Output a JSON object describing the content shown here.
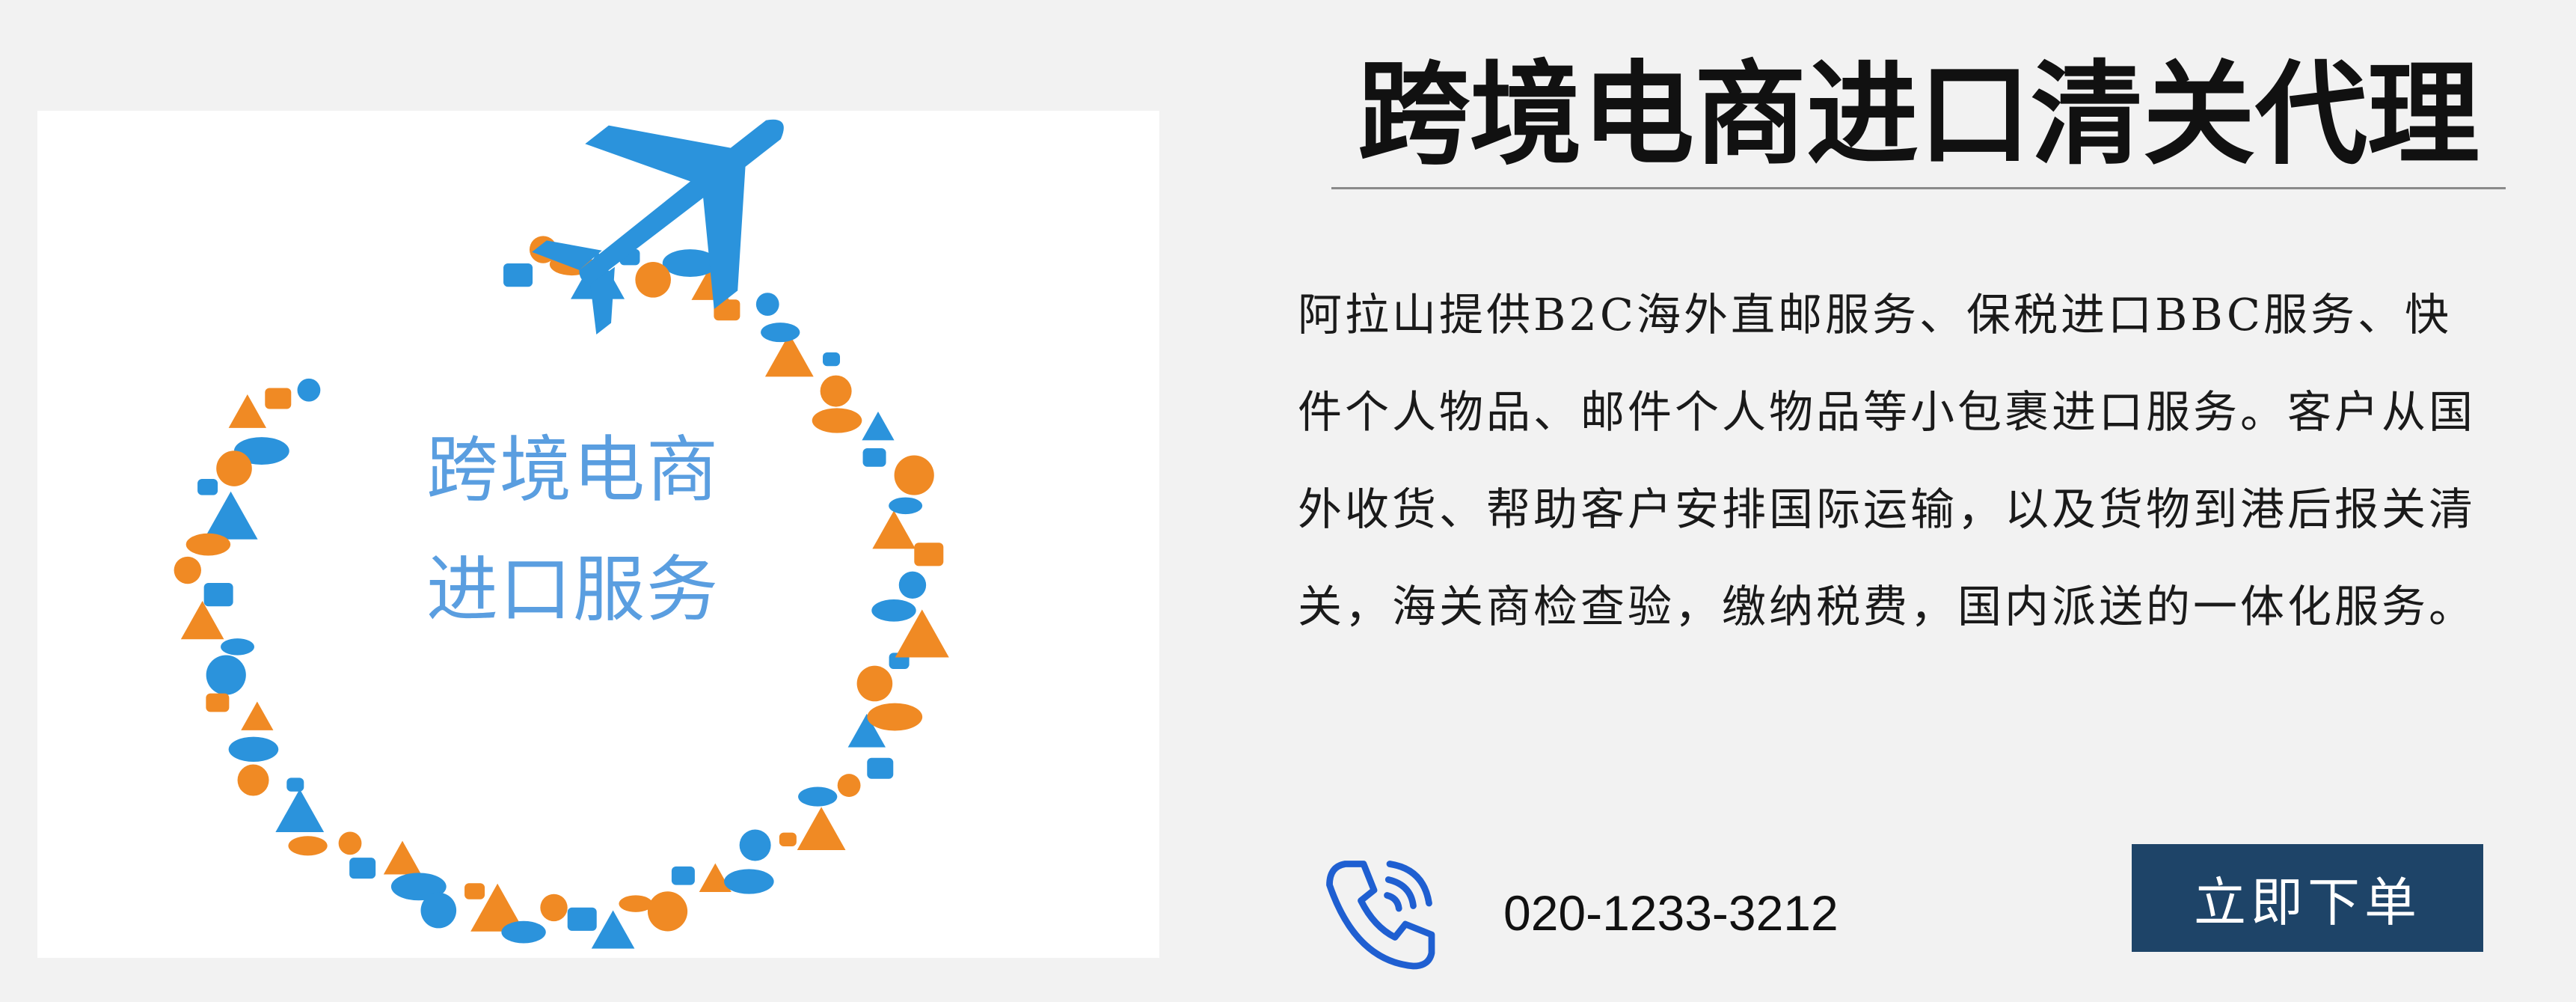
{
  "promo_image": {
    "caption_line1": "跨境电商",
    "caption_line2": "进口服务",
    "icon": "airplane-icon",
    "colors": {
      "blue": "#2b93dc",
      "orange": "#f08a24",
      "caption": "#5a9ee0"
    }
  },
  "header": {
    "title": "跨境电商进口清关代理"
  },
  "description": "阿拉山提供B2C海外直邮服务、保税进口BBC服务、快件个人物品、邮件个人物品等小包裹进口服务。客户从国外收货、帮助客户安排国际运输，以及货物到港后报关清关，海关商检查验，缴纳税费，国内派送的一体化服务。",
  "contact": {
    "phone_icon": "phone-icon",
    "phone_number": "020-1233-3212"
  },
  "cta": {
    "label": "立即下单",
    "color": "#1e4468"
  }
}
